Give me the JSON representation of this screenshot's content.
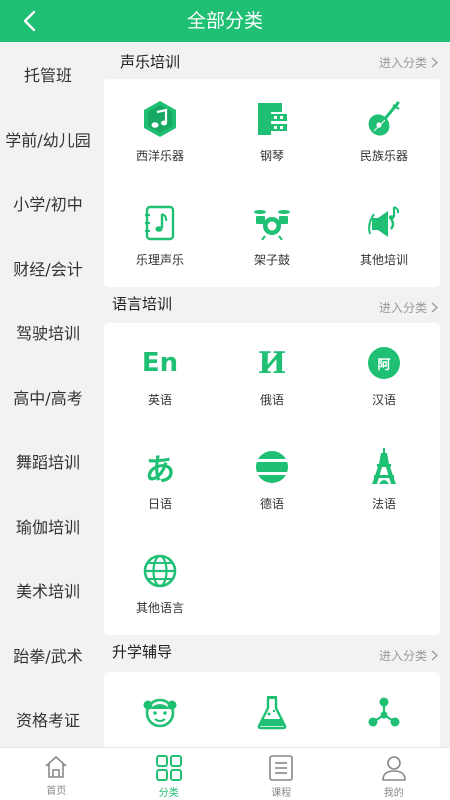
{
  "header": {
    "title": "全部分类"
  },
  "sidebar": {
    "items": [
      "托管班",
      "学前/幼儿园",
      "小学/初中",
      "财经/会计",
      "驾驶培训",
      "高中/高考",
      "舞蹈培训",
      "瑜伽培训",
      "美术培训",
      "跆拳/武术",
      "资格考证"
    ]
  },
  "sections": [
    {
      "title": "声乐培训",
      "more": "进入分类",
      "items": [
        {
          "label": "西洋乐器",
          "icon": "western-instrument-icon"
        },
        {
          "label": "钢琴",
          "icon": "piano-icon"
        },
        {
          "label": "民族乐器",
          "icon": "pipa-icon"
        },
        {
          "label": "乐理声乐",
          "icon": "music-theory-icon"
        },
        {
          "label": "架子鼓",
          "icon": "drum-kit-icon"
        },
        {
          "label": "其他培训",
          "icon": "speaker-note-icon"
        }
      ]
    },
    {
      "title": "语言培训",
      "more": "进入分类",
      "items": [
        {
          "label": "英语",
          "icon": "english-icon",
          "glyph": "En"
        },
        {
          "label": "俄语",
          "icon": "russian-icon",
          "glyph": "И"
        },
        {
          "label": "汉语",
          "icon": "chinese-icon",
          "glyph": "阿"
        },
        {
          "label": "日语",
          "icon": "japanese-icon",
          "glyph": "あ"
        },
        {
          "label": "德语",
          "icon": "german-icon"
        },
        {
          "label": "法语",
          "icon": "eiffel-tower-icon"
        },
        {
          "label": "其他语言",
          "icon": "globe-icon"
        }
      ]
    },
    {
      "title": "升学辅导",
      "more": "进入分类",
      "items": [
        {
          "label": "",
          "icon": "child-face-icon"
        },
        {
          "label": "",
          "icon": "flask-icon"
        },
        {
          "label": "",
          "icon": "molecule-icon"
        }
      ]
    }
  ],
  "tabbar": {
    "items": [
      {
        "label": "首页",
        "icon": "home-icon"
      },
      {
        "label": "分类",
        "icon": "grid-icon",
        "active": true
      },
      {
        "label": "课程",
        "icon": "course-list-icon"
      },
      {
        "label": "我的",
        "icon": "profile-icon"
      }
    ]
  },
  "colors": {
    "accent": "#1fbf74",
    "background": "#f2f2f2",
    "text": "#333333",
    "muted": "#9a9a9a"
  }
}
